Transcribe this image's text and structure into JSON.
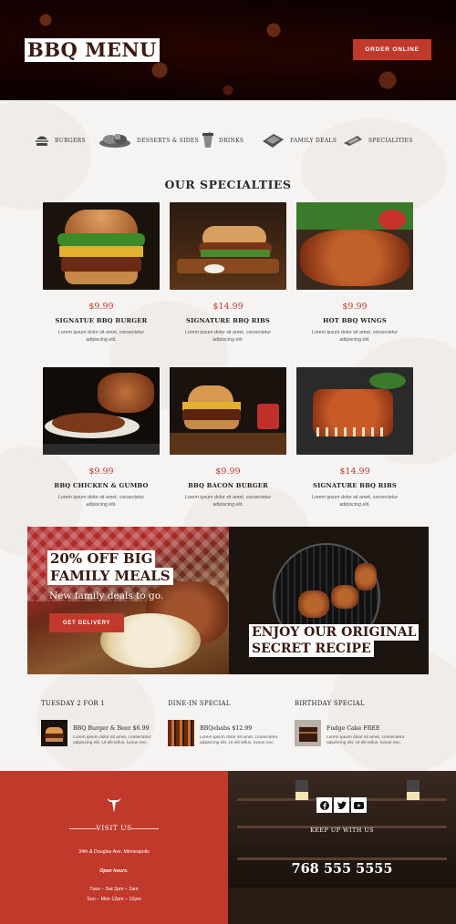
{
  "header": {
    "title": "BBQ MENU",
    "order_button": "ORDER ONLINE"
  },
  "categories": [
    {
      "label": "BURGERS",
      "icon": "burger-icon"
    },
    {
      "label": "DESSERTS & SIDES",
      "icon": "sides-icon"
    },
    {
      "label": "DRINKS",
      "icon": "drink-icon"
    },
    {
      "label": "FAMILY DEALS",
      "icon": "family-deal-icon"
    },
    {
      "label": "SPECIALITIES",
      "icon": "speciality-icon"
    }
  ],
  "specialties": {
    "title": "OUR SPECIALTIES",
    "items": [
      {
        "price": "$9.99",
        "name": "SIGNATUE BBQ BURGER",
        "desc": "Lorem ipsum dolor sit amet, consectetur adipiscing elit."
      },
      {
        "price": "$14.99",
        "name": "SIGNATURE BBQ RIBS",
        "desc": "Lorem ipsum dolor sit amet, consectetur adipiscing elit."
      },
      {
        "price": "$9.99",
        "name": "HOT BBQ WINGS",
        "desc": "Lorem ipsum dolor sit amet, consectetur adipiscing elit."
      },
      {
        "price": "$9.99",
        "name": "BBQ CHICKEN & GUMBO",
        "desc": "Lorem ipsum dolor sit amet, consectetur adipiscing elit."
      },
      {
        "price": "$9.99",
        "name": "BBQ BACON BURGER",
        "desc": "Lorem ipsum dolor sit amet, consectetur adipiscing elit."
      },
      {
        "price": "$14.99",
        "name": "SIGNATURE BBQ RIBS",
        "desc": "Lorem ipsum dolor sit amet, consectetur adipiscing elit."
      }
    ]
  },
  "promo": {
    "headline_line1": "20% OFF BIG",
    "headline_line2": "FAMILY MEALS",
    "subtitle": "New family deals to go.",
    "button": "GET DELIVERY",
    "right_line1": "ENJOY OUR ORIGINAL",
    "right_line2": "SECRET RECIPE"
  },
  "specials": [
    {
      "heading": "TUESDAY 2 FOR 1",
      "title": "BBQ Burger & Beer $6.99",
      "desc": "Lorem ipsum dolor sit amet, consectetur adipiscing elit. Ut elit tellus, luctus nec."
    },
    {
      "heading": "DINE-IN SPECIAL",
      "title": "BBQebabs $12.99",
      "desc": "Lorem ipsum dolor sit amet, consectetur adipiscing elit. Ut elit tellus, luctus nec."
    },
    {
      "heading": "BIRTHDAY SPECIAL",
      "title": "Fudge Cake FREE",
      "desc": "Lorem ipsum dolor sit amet, consectetur adipiscing elit. Ut elit tellus, luctus nec."
    }
  ],
  "footer": {
    "visit_label": "VISIT US",
    "address": "34th & Douglas Ave. Minneapolis",
    "open_hours_label": "Open hours:",
    "hours_1": "Tues – Sat 2pm – 2am",
    "hours_2": "Sun – Mon 12pm – 12pm",
    "social_label": "KEEP UP WITH US",
    "phone": "768 555 5555",
    "social_icons": [
      "facebook-icon",
      "twitter-icon",
      "youtube-icon"
    ]
  },
  "colors": {
    "accent": "#c0392b",
    "dark": "#3a1a10"
  }
}
